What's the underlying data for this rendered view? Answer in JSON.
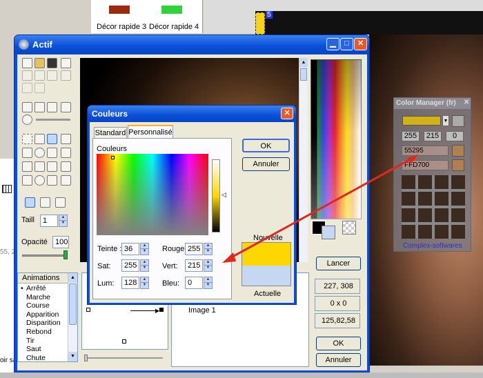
{
  "background": {
    "quick_colors": [
      {
        "label": "Décor rapide 3",
        "color": "#9b2a12"
      },
      {
        "label": "Décor rapide 4",
        "color": "#32d23c"
      }
    ],
    "layer_number": "5",
    "left_pane": {
      "size_label": "Taill",
      "status": "oir sa",
      "stray": "55, 2"
    }
  },
  "main": {
    "title": "Actif",
    "size_label": "Taill",
    "size_value": "1",
    "opacity_label": "Opacité",
    "opacity_value": "100",
    "animations": {
      "header": "Animations",
      "items": [
        "Arrêté",
        "Marche",
        "Course",
        "Apparition",
        "Disparition",
        "Rebond",
        "Tir",
        "Saut",
        "Chute"
      ],
      "selected": "Arrêté"
    },
    "frame_label": "Image 1",
    "launch_button": "Lancer",
    "readouts": [
      "227, 308",
      "0 x 0",
      "125,82,58"
    ],
    "ok_button": "OK",
    "cancel_button": "Annuler"
  },
  "couleurs": {
    "title": "Couleurs",
    "tabs": [
      "Standard",
      "Personnalisé"
    ],
    "active_tab": "Personnalisé",
    "section_label": "Couleurs",
    "fields": [
      {
        "label": "Teinte :",
        "value": "36"
      },
      {
        "label": "Sat:",
        "value": "255"
      },
      {
        "label": "Lum:",
        "value": "128"
      },
      {
        "label": "Rouge:",
        "value": "255"
      },
      {
        "label": "Vert:",
        "value": "215"
      },
      {
        "label": "Bleu:",
        "value": "0"
      }
    ],
    "new_label": "Nouvelle",
    "current_label": "Actuelle",
    "new_color": "#ffd700",
    "current_color": "#c6d7f2",
    "ok_button": "OK",
    "cancel_button": "Annuler"
  },
  "color_manager": {
    "title": "Color Manager (fr)",
    "swatch_color": "#d2b018",
    "rgb": [
      "255",
      "215",
      "0"
    ],
    "field_1": "55295",
    "field_2": "FFD700",
    "footer": "Complex-softwares"
  },
  "colors": {
    "titlebar": "#0a4fd8",
    "accent_red": "#e0281e",
    "selection_blue": "#316ac5"
  }
}
